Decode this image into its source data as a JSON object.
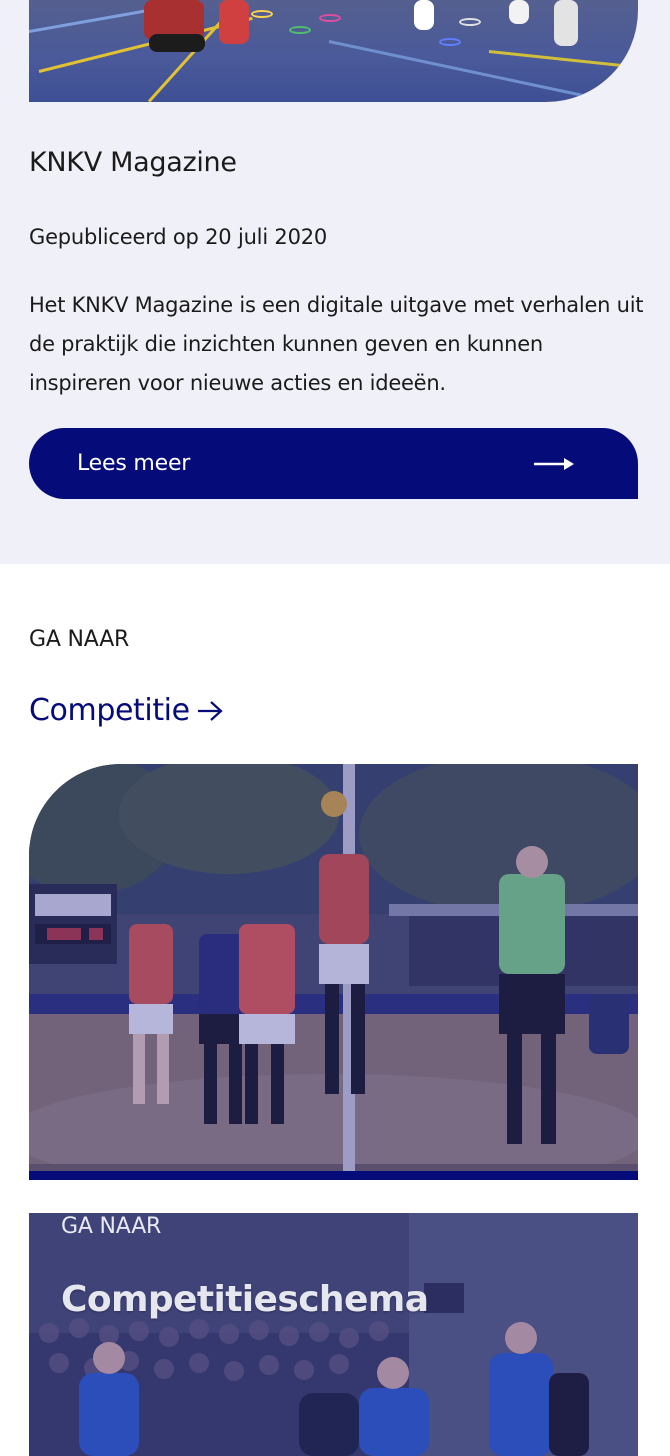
{
  "article": {
    "title": "KNKV Magazine",
    "date": "Gepubliceerd op 20 juli 2020",
    "body": "Het KNKV Magazine is een digitale uitgave met verhalen uit de praktijk die inzichten kunnen geven en kunnen inspireren voor nieuwe acties en ideeën.",
    "read_more_label": "Lees meer",
    "read_more_icon": "arrow-right-icon"
  },
  "goto": {
    "label": "GA NAAR",
    "competition_link": "Competitie",
    "competition_icon": "arrow-right-icon"
  },
  "card_schedule": {
    "goto_label": "GA NAAR",
    "title": "Competitieschema"
  },
  "colors": {
    "brand_navy": "#050b78",
    "section_bg": "#f0f0f8"
  }
}
